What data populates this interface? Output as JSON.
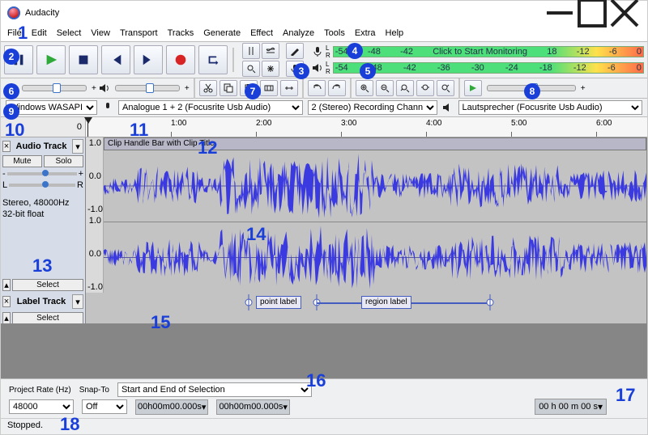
{
  "title": "Audacity",
  "menubar": [
    "File",
    "Edit",
    "Select",
    "View",
    "Transport",
    "Tracks",
    "Generate",
    "Effect",
    "Analyze",
    "Tools",
    "Extra",
    "Help"
  ],
  "transport": {
    "pause": "Pause",
    "play": "Play",
    "stop": "Stop",
    "skip_start": "Skip to Start",
    "skip_end": "Skip to End",
    "record": "Record",
    "loop": "Loop"
  },
  "rec_meter_hint": "Click to Start Monitoring",
  "rec_meter_ticks": [
    "-54",
    "-48",
    "-42"
  ],
  "rec_meter_ticks2": [
    "18",
    "-12",
    "-6",
    "0"
  ],
  "play_meter_ticks": [
    "-54",
    "-48",
    "-42",
    "-36",
    "-30",
    "-24",
    "-18",
    "-12",
    "-6",
    "0"
  ],
  "lr": "L\nR",
  "device": {
    "host": "Windows WASAPI",
    "rec": "Analogue 1 + 2 (Focusrite Usb Audio)",
    "channels": "2 (Stereo) Recording Chann",
    "play": "Lautsprecher (Focusrite Usb Audio)"
  },
  "timeline": {
    "start": "0",
    "marks": [
      "1:00",
      "2:00",
      "3:00",
      "4:00",
      "5:00",
      "6:00"
    ]
  },
  "audio_track": {
    "name": "Audio Track",
    "mute": "Mute",
    "solo": "Solo",
    "format": "Stereo, 48000Hz",
    "bits": "32-bit float",
    "select": "Select",
    "clip_title": "Clip Handle Bar with Clip Title",
    "yticks": [
      "1.0",
      "0.0",
      "-1.0"
    ]
  },
  "label_track": {
    "name": "Label Track",
    "select": "Select",
    "point": "point label",
    "region": "region label"
  },
  "selection": {
    "rate_label": "Project Rate (Hz)",
    "rate": "48000",
    "snap_label": "Snap-To",
    "snap": "Off",
    "mode": "Start and End of Selection",
    "start": "00h00m00.000s",
    "end": "00h00m00.000s",
    "position": "00 h 00 m 00 s"
  },
  "status": "Stopped.",
  "annotations": {
    "1": "1",
    "2": "2",
    "3": "3",
    "4": "4",
    "5": "5",
    "6": "6",
    "7": "7",
    "8": "8",
    "9": "9",
    "10": "10",
    "11": "11",
    "12": "12",
    "13": "13",
    "14": "14",
    "15": "15",
    "16": "16",
    "17": "17",
    "18": "18"
  }
}
